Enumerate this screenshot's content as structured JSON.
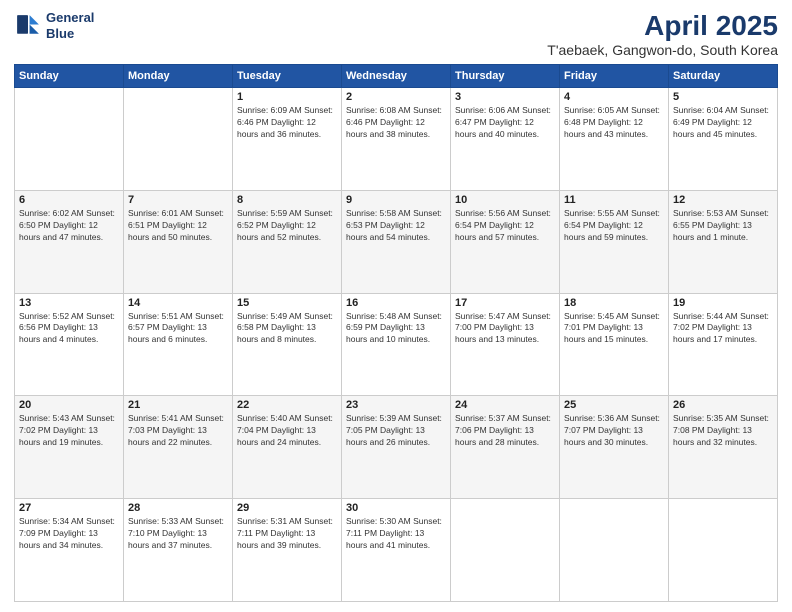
{
  "logo": {
    "line1": "General",
    "line2": "Blue"
  },
  "header": {
    "title": "April 2025",
    "subtitle": "T'aebaek, Gangwon-do, South Korea"
  },
  "weekdays": [
    "Sunday",
    "Monday",
    "Tuesday",
    "Wednesday",
    "Thursday",
    "Friday",
    "Saturday"
  ],
  "weeks": [
    [
      {
        "day": "",
        "info": ""
      },
      {
        "day": "",
        "info": ""
      },
      {
        "day": "1",
        "info": "Sunrise: 6:09 AM\nSunset: 6:46 PM\nDaylight: 12 hours\nand 36 minutes."
      },
      {
        "day": "2",
        "info": "Sunrise: 6:08 AM\nSunset: 6:46 PM\nDaylight: 12 hours\nand 38 minutes."
      },
      {
        "day": "3",
        "info": "Sunrise: 6:06 AM\nSunset: 6:47 PM\nDaylight: 12 hours\nand 40 minutes."
      },
      {
        "day": "4",
        "info": "Sunrise: 6:05 AM\nSunset: 6:48 PM\nDaylight: 12 hours\nand 43 minutes."
      },
      {
        "day": "5",
        "info": "Sunrise: 6:04 AM\nSunset: 6:49 PM\nDaylight: 12 hours\nand 45 minutes."
      }
    ],
    [
      {
        "day": "6",
        "info": "Sunrise: 6:02 AM\nSunset: 6:50 PM\nDaylight: 12 hours\nand 47 minutes."
      },
      {
        "day": "7",
        "info": "Sunrise: 6:01 AM\nSunset: 6:51 PM\nDaylight: 12 hours\nand 50 minutes."
      },
      {
        "day": "8",
        "info": "Sunrise: 5:59 AM\nSunset: 6:52 PM\nDaylight: 12 hours\nand 52 minutes."
      },
      {
        "day": "9",
        "info": "Sunrise: 5:58 AM\nSunset: 6:53 PM\nDaylight: 12 hours\nand 54 minutes."
      },
      {
        "day": "10",
        "info": "Sunrise: 5:56 AM\nSunset: 6:54 PM\nDaylight: 12 hours\nand 57 minutes."
      },
      {
        "day": "11",
        "info": "Sunrise: 5:55 AM\nSunset: 6:54 PM\nDaylight: 12 hours\nand 59 minutes."
      },
      {
        "day": "12",
        "info": "Sunrise: 5:53 AM\nSunset: 6:55 PM\nDaylight: 13 hours\nand 1 minute."
      }
    ],
    [
      {
        "day": "13",
        "info": "Sunrise: 5:52 AM\nSunset: 6:56 PM\nDaylight: 13 hours\nand 4 minutes."
      },
      {
        "day": "14",
        "info": "Sunrise: 5:51 AM\nSunset: 6:57 PM\nDaylight: 13 hours\nand 6 minutes."
      },
      {
        "day": "15",
        "info": "Sunrise: 5:49 AM\nSunset: 6:58 PM\nDaylight: 13 hours\nand 8 minutes."
      },
      {
        "day": "16",
        "info": "Sunrise: 5:48 AM\nSunset: 6:59 PM\nDaylight: 13 hours\nand 10 minutes."
      },
      {
        "day": "17",
        "info": "Sunrise: 5:47 AM\nSunset: 7:00 PM\nDaylight: 13 hours\nand 13 minutes."
      },
      {
        "day": "18",
        "info": "Sunrise: 5:45 AM\nSunset: 7:01 PM\nDaylight: 13 hours\nand 15 minutes."
      },
      {
        "day": "19",
        "info": "Sunrise: 5:44 AM\nSunset: 7:02 PM\nDaylight: 13 hours\nand 17 minutes."
      }
    ],
    [
      {
        "day": "20",
        "info": "Sunrise: 5:43 AM\nSunset: 7:02 PM\nDaylight: 13 hours\nand 19 minutes."
      },
      {
        "day": "21",
        "info": "Sunrise: 5:41 AM\nSunset: 7:03 PM\nDaylight: 13 hours\nand 22 minutes."
      },
      {
        "day": "22",
        "info": "Sunrise: 5:40 AM\nSunset: 7:04 PM\nDaylight: 13 hours\nand 24 minutes."
      },
      {
        "day": "23",
        "info": "Sunrise: 5:39 AM\nSunset: 7:05 PM\nDaylight: 13 hours\nand 26 minutes."
      },
      {
        "day": "24",
        "info": "Sunrise: 5:37 AM\nSunset: 7:06 PM\nDaylight: 13 hours\nand 28 minutes."
      },
      {
        "day": "25",
        "info": "Sunrise: 5:36 AM\nSunset: 7:07 PM\nDaylight: 13 hours\nand 30 minutes."
      },
      {
        "day": "26",
        "info": "Sunrise: 5:35 AM\nSunset: 7:08 PM\nDaylight: 13 hours\nand 32 minutes."
      }
    ],
    [
      {
        "day": "27",
        "info": "Sunrise: 5:34 AM\nSunset: 7:09 PM\nDaylight: 13 hours\nand 34 minutes."
      },
      {
        "day": "28",
        "info": "Sunrise: 5:33 AM\nSunset: 7:10 PM\nDaylight: 13 hours\nand 37 minutes."
      },
      {
        "day": "29",
        "info": "Sunrise: 5:31 AM\nSunset: 7:11 PM\nDaylight: 13 hours\nand 39 minutes."
      },
      {
        "day": "30",
        "info": "Sunrise: 5:30 AM\nSunset: 7:11 PM\nDaylight: 13 hours\nand 41 minutes."
      },
      {
        "day": "",
        "info": ""
      },
      {
        "day": "",
        "info": ""
      },
      {
        "day": "",
        "info": ""
      }
    ]
  ]
}
